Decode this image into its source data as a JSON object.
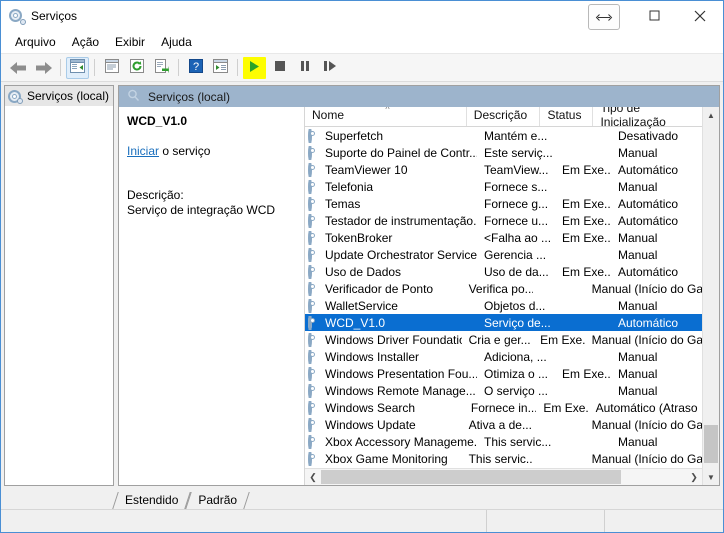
{
  "window": {
    "title": "Serviços",
    "icon": "services-gear-icon",
    "controls": {
      "minimize": "minimize-button",
      "maximize": "maximize-button",
      "close": "close-button",
      "resize_cursor": "horizontal-resize-cursor"
    }
  },
  "menu": {
    "items": [
      "Arquivo",
      "Ação",
      "Exibir",
      "Ajuda"
    ]
  },
  "toolbar": {
    "buttons": [
      {
        "name": "back-button",
        "icon": "left-arrow-icon"
      },
      {
        "name": "forward-button",
        "icon": "right-arrow-icon"
      },
      {
        "name": "show-hide-tree-button",
        "icon": "tree-panel-icon",
        "state": "active"
      },
      {
        "name": "properties-button",
        "icon": "properties-icon"
      },
      {
        "name": "refresh-button",
        "icon": "refresh-icon"
      },
      {
        "name": "export-list-button",
        "icon": "export-icon"
      },
      {
        "name": "help-button",
        "icon": "question-mark-icon"
      },
      {
        "name": "show-action-pane-button",
        "icon": "console-view-icon"
      },
      {
        "name": "start-service-button",
        "icon": "play-icon",
        "state": "highlighted"
      },
      {
        "name": "stop-service-button",
        "icon": "stop-icon"
      },
      {
        "name": "pause-service-button",
        "icon": "pause-icon"
      },
      {
        "name": "restart-service-button",
        "icon": "restart-icon"
      }
    ]
  },
  "tree": {
    "root_label": "Serviços (local)"
  },
  "pane": {
    "header": "Serviços (local)",
    "detail": {
      "service_name": "WCD_V1.0",
      "action_link": "Iniciar",
      "action_suffix": " o serviço",
      "description_label": "Descrição:",
      "description_text": "Serviço de integração WCD"
    }
  },
  "list": {
    "columns": [
      "Nome",
      "Descrição",
      "Status",
      "Tipo de Inicialização"
    ],
    "sort_column": "Nome",
    "sort_direction": "ascending",
    "rows": [
      {
        "nome": "Superfetch",
        "descricao": "Mantém e...",
        "status": "",
        "tipo": "Desativado",
        "selected": false
      },
      {
        "nome": "Suporte do Painel de Contr...",
        "descricao": "Este serviç...",
        "status": "",
        "tipo": "Manual",
        "selected": false
      },
      {
        "nome": "TeamViewer 10",
        "descricao": "TeamView...",
        "status": "Em Exe...",
        "tipo": "Automático",
        "selected": false
      },
      {
        "nome": "Telefonia",
        "descricao": "Fornece s...",
        "status": "",
        "tipo": "Manual",
        "selected": false
      },
      {
        "nome": "Temas",
        "descricao": "Fornece g...",
        "status": "Em Exe...",
        "tipo": "Automático",
        "selected": false
      },
      {
        "nome": "Testador de instrumentação...",
        "descricao": "Fornece u...",
        "status": "Em Exe...",
        "tipo": "Automático",
        "selected": false
      },
      {
        "nome": "TokenBroker",
        "descricao": "<Falha ao ...",
        "status": "Em Exe...",
        "tipo": "Manual",
        "selected": false
      },
      {
        "nome": "Update Orchestrator Service",
        "descricao": "Gerencia ...",
        "status": "",
        "tipo": "Manual",
        "selected": false
      },
      {
        "nome": "Uso de Dados",
        "descricao": "Uso de da...",
        "status": "Em Exe...",
        "tipo": "Automático",
        "selected": false
      },
      {
        "nome": "Verificador de Ponto",
        "descricao": "Verifica po...",
        "status": "",
        "tipo": "Manual (Início do Ga...",
        "selected": false
      },
      {
        "nome": "WalletService",
        "descricao": "Objetos d...",
        "status": "",
        "tipo": "Manual",
        "selected": false
      },
      {
        "nome": "WCD_V1.0",
        "descricao": "Serviço de...",
        "status": "",
        "tipo": "Automático",
        "selected": true
      },
      {
        "nome": "Windows Driver Foundation...",
        "descricao": "Cria e ger...",
        "status": "Em Exe...",
        "tipo": "Manual (Início do Ga...",
        "selected": false
      },
      {
        "nome": "Windows Installer",
        "descricao": "Adiciona, ...",
        "status": "",
        "tipo": "Manual",
        "selected": false
      },
      {
        "nome": "Windows Presentation Fou...",
        "descricao": "Otimiza o ...",
        "status": "Em Exe...",
        "tipo": "Manual",
        "selected": false
      },
      {
        "nome": "Windows Remote Manage...",
        "descricao": "O serviço ...",
        "status": "",
        "tipo": "Manual",
        "selected": false
      },
      {
        "nome": "Windows Search",
        "descricao": "Fornece in...",
        "status": "Em Exe...",
        "tipo": "Automático (Atraso ...",
        "selected": false
      },
      {
        "nome": "Windows Update",
        "descricao": "Ativa a de...",
        "status": "",
        "tipo": "Manual (Início do Ga...",
        "selected": false
      },
      {
        "nome": "Xbox Accessory Manageme...",
        "descricao": "This servic...",
        "status": "",
        "tipo": "Manual",
        "selected": false
      },
      {
        "nome": "Xbox Game Monitoring",
        "descricao": "This servic...",
        "status": "",
        "tipo": "Manual (Início do Ga...",
        "selected": false
      }
    ]
  },
  "tabs": {
    "items": [
      "Estendido",
      "Padrão"
    ],
    "active": "Padrão"
  },
  "colors": {
    "selection": "#0a6ed1",
    "pane_header": "#9db4cc",
    "highlight": "#fdfd00",
    "play_green": "#29a329",
    "link": "#1a6fbd",
    "window_border": "#4a8fd4"
  }
}
